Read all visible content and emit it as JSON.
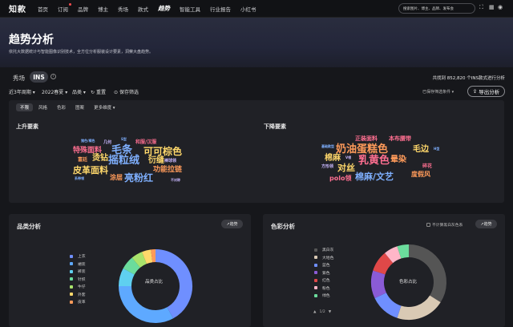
{
  "app": {
    "logo": "知款",
    "nav": [
      {
        "label": "首页"
      },
      {
        "label": "订阅",
        "dot": true
      },
      {
        "label": "品牌"
      },
      {
        "label": "博主"
      },
      {
        "label": "秀场"
      },
      {
        "label": "款式"
      },
      {
        "label": "趋势",
        "active": true
      },
      {
        "label": "智能工具"
      },
      {
        "label": "行业报告"
      },
      {
        "label": "小红书"
      }
    ],
    "search_placeholder": "搜索图片、博主、品牌、发布会"
  },
  "hero": {
    "title": "趋势分析",
    "subtitle": "依托大数据统计与智能图像识别技术，全方位分析服装设计要素，洞察大盘趋势。"
  },
  "tabs": {
    "show": "秀场",
    "ins": "INS",
    "info": "i",
    "result_text": "共找到 852,820 个INS款式进行分析"
  },
  "filters": {
    "period": "近3年周期",
    "season": "2022春夏",
    "category": "品类",
    "reset": "重置",
    "save": "保存筛选",
    "sort_label": "已保存筛选条件",
    "export": "导出分析"
  },
  "elements": {
    "sub_tabs": [
      "不限",
      "风格",
      "色彩",
      "图案",
      "更多维度"
    ],
    "rising_label": "上升要素",
    "falling_label": "下降要素",
    "rising_words": [
      {
        "text": "猪色/褐色",
        "color": "#7fb0ff",
        "size": 4
      },
      {
        "text": "几何",
        "color": "#c9b8ff",
        "size": 5
      },
      {
        "text": "S型",
        "color": "#7fb0ff",
        "size": 4
      },
      {
        "text": "和服/汉服",
        "color": "#ff6f91",
        "size": 6
      },
      {
        "text": "特殊面料",
        "color": "#ff6f91",
        "size": 9
      },
      {
        "text": "毛条",
        "color": "#7fb0ff",
        "size": 13
      },
      {
        "text": "可可棕色",
        "color": "#ffd86b",
        "size": 12
      },
      {
        "text": "富廷",
        "color": "#ff9b5a",
        "size": 6
      },
      {
        "text": "烫钻",
        "color": "#ffd86b",
        "size": 10
      },
      {
        "text": "摇粒绒",
        "color": "#7fb0ff",
        "size": 13
      },
      {
        "text": "衍缝",
        "color": "#ffd86b",
        "size": 10
      },
      {
        "text": "棒球领",
        "color": "#c9b8ff",
        "size": 5
      },
      {
        "text": "皮革面料",
        "color": "#ffd86b",
        "size": 11
      },
      {
        "text": "功能拉链",
        "color": "#ff9b5a",
        "size": 9
      },
      {
        "text": "系带领",
        "color": "#7fb0ff",
        "size": 4
      },
      {
        "text": "涂层",
        "color": "#ff9b5a",
        "size": 8
      },
      {
        "text": "亮粉红",
        "color": "#7fb0ff",
        "size": 12
      },
      {
        "text": "不对称",
        "color": "#c9b8ff",
        "size": 4
      }
    ],
    "falling_words": [
      {
        "text": "正装面料",
        "color": "#ff6f91",
        "size": 7
      },
      {
        "text": "本布腰带",
        "color": "#ff6f91",
        "size": 7
      },
      {
        "text": "基础款型",
        "color": "#7fb0ff",
        "size": 4
      },
      {
        "text": "奶油蛋糕色",
        "color": "#ff9b5a",
        "size": 13
      },
      {
        "text": "毛边",
        "color": "#ffd86b",
        "size": 10
      },
      {
        "text": "H型",
        "color": "#7fb0ff",
        "size": 4
      },
      {
        "text": "棉麻",
        "color": "#ffd86b",
        "size": 10
      },
      {
        "text": "V领",
        "color": "#c9b8ff",
        "size": 4
      },
      {
        "text": "乳黄色",
        "color": "#ff6f91",
        "size": 13
      },
      {
        "text": "晕染",
        "color": "#ff9b5a",
        "size": 10
      },
      {
        "text": "方形领",
        "color": "#c9b8ff",
        "size": 5
      },
      {
        "text": "对丝",
        "color": "#ffd86b",
        "size": 11
      },
      {
        "text": "碎花",
        "color": "#ff6f91",
        "size": 6
      },
      {
        "text": "polo领",
        "color": "#ff6f91",
        "size": 8
      },
      {
        "text": "棉麻/文艺",
        "color": "#7fb0ff",
        "size": 11
      },
      {
        "text": "度假风",
        "color": "#ff9b5a",
        "size": 8
      }
    ]
  },
  "category_panel": {
    "title": "品类分析",
    "trend_btn": "趋势",
    "center_label": "品类占比",
    "legend": [
      {
        "label": "上衣",
        "color": "#6f8fff"
      },
      {
        "label": "裙装",
        "color": "#5ea9ff"
      },
      {
        "label": "裤装",
        "color": "#5fd0f0"
      },
      {
        "label": "针织",
        "color": "#6bdc9c"
      },
      {
        "label": "牛仔",
        "color": "#a9e36b"
      },
      {
        "label": "外套",
        "color": "#ffd86b"
      },
      {
        "label": "皮革",
        "color": "#ff9b5a"
      }
    ],
    "shares": [
      0.42,
      0.33,
      0.08,
      0.06,
      0.05,
      0.04,
      0.02
    ]
  },
  "color_panel": {
    "title": "色彩分析",
    "trend_btn": "趋势",
    "checkbox_label": "不计算黑白灰色系",
    "center_label": "色彩占比",
    "legend": [
      {
        "label": "黑白灰",
        "color": "#555555"
      },
      {
        "label": "大地色",
        "color": "#d9c9b4"
      },
      {
        "label": "蓝色",
        "color": "#6f8fff"
      },
      {
        "label": "紫色",
        "color": "#8a5bd6"
      },
      {
        "label": "红色",
        "color": "#e04848"
      },
      {
        "label": "粉色",
        "color": "#ffb6c8"
      },
      {
        "label": "绿色",
        "color": "#6bdc9c"
      }
    ],
    "shares": [
      0.34,
      0.21,
      0.13,
      0.12,
      0.09,
      0.06,
      0.05
    ],
    "pager": "1/2"
  }
}
